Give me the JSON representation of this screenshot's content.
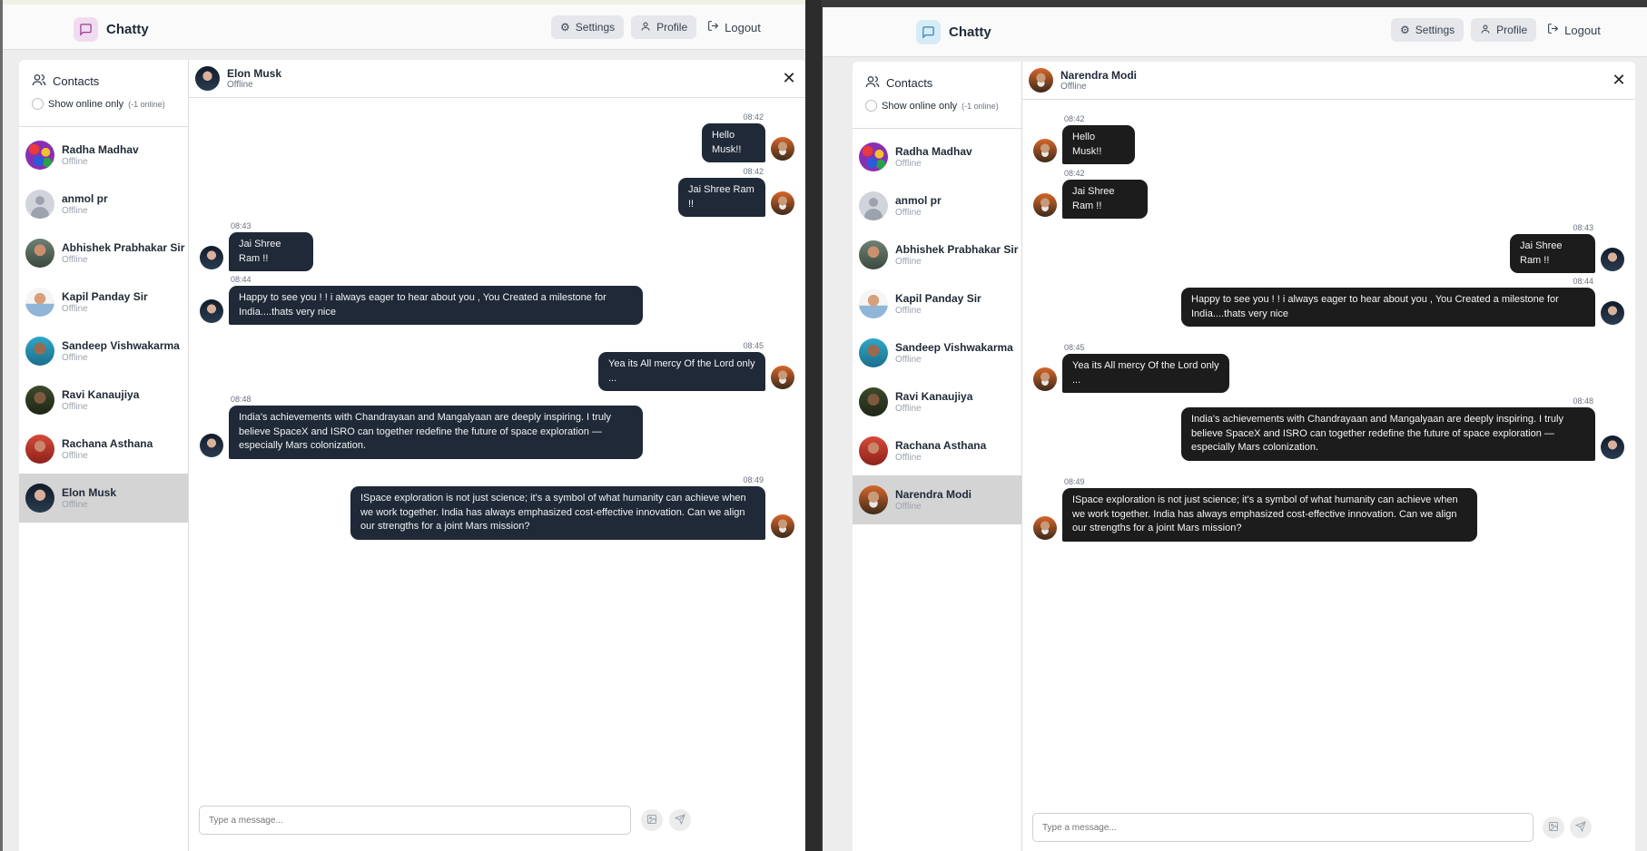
{
  "app": {
    "name": "Chatty"
  },
  "nav": {
    "settings": "Settings",
    "profile": "Profile",
    "logout": "Logout"
  },
  "sidebar": {
    "title": "Contacts",
    "filter_label": "Show online only",
    "online_count": "(-1 online)"
  },
  "composer": {
    "placeholder": "Type a message..."
  },
  "left": {
    "contacts": [
      {
        "name": "Radha Madhav",
        "status": "Offline",
        "avatar": "av-radha"
      },
      {
        "name": "anmol pr",
        "status": "Offline",
        "avatar": "av-anmol"
      },
      {
        "name": "Abhishek Prabhakar Sir",
        "status": "Offline",
        "avatar": "av-abhishek"
      },
      {
        "name": "Kapil Panday Sir",
        "status": "Offline",
        "avatar": "av-kapil"
      },
      {
        "name": "Sandeep Vishwakarma",
        "status": "Offline",
        "avatar": "av-sandeep"
      },
      {
        "name": "Ravi Kanaujiya",
        "status": "Offline",
        "avatar": "av-ravi"
      },
      {
        "name": "Rachana Asthana",
        "status": "Offline",
        "avatar": "av-rachana"
      },
      {
        "name": "Elon Musk",
        "status": "Offline",
        "avatar": "av-elon"
      }
    ],
    "chat_header": {
      "name": "Elon Musk",
      "status": "Offline"
    },
    "messages": [
      {
        "time": "08:42",
        "text": "Hello Musk!!"
      },
      {
        "time": "08:42",
        "text": "Jai Shree Ram !!"
      },
      {
        "time": "08:43",
        "text": "Jai Shree Ram !!"
      },
      {
        "time": "08:44",
        "text": "Happy to see you ! ! i always eager to hear about you , You Created a milestone for India....thats very nice"
      },
      {
        "time": "08:45",
        "text": "Yea its All mercy Of the Lord only ..."
      },
      {
        "time": "08:48",
        "text": "India's achievements with Chandrayaan and Mangalyaan are deeply inspiring. I truly believe SpaceX and ISRO can together redefine the future of space exploration — especially Mars colonization."
      },
      {
        "time": "08:49",
        "text": "ISpace exploration is not just science; it's a symbol of what humanity can achieve when we work together. India has always emphasized cost-effective innovation. Can we align our strengths for a joint Mars mission?"
      }
    ]
  },
  "right": {
    "contacts": [
      {
        "name": "Radha Madhav",
        "status": "Offline",
        "avatar": "av-radha"
      },
      {
        "name": "anmol pr",
        "status": "Offline",
        "avatar": "av-anmol"
      },
      {
        "name": "Abhishek Prabhakar Sir",
        "status": "Offline",
        "avatar": "av-abhishek"
      },
      {
        "name": "Kapil Panday Sir",
        "status": "Offline",
        "avatar": "av-kapil"
      },
      {
        "name": "Sandeep Vishwakarma",
        "status": "Offline",
        "avatar": "av-sandeep"
      },
      {
        "name": "Ravi Kanaujiya",
        "status": "Offline",
        "avatar": "av-ravi"
      },
      {
        "name": "Rachana Asthana",
        "status": "Offline",
        "avatar": "av-rachana"
      },
      {
        "name": "Narendra Modi",
        "status": "Offline",
        "avatar": "av-modi"
      }
    ],
    "chat_header": {
      "name": "Narendra Modi",
      "status": "Offline"
    },
    "messages": [
      {
        "time": "08:42",
        "text": "Hello Musk!!"
      },
      {
        "time": "08:42",
        "text": "Jai Shree Ram !!"
      },
      {
        "time": "08:43",
        "text": "Jai Shree Ram !!"
      },
      {
        "time": "08:44",
        "text": "Happy to see you ! ! i always eager to hear about you , You Created a milestone for India....thats very nice"
      },
      {
        "time": "08:45",
        "text": "Yea its All mercy Of the Lord only ..."
      },
      {
        "time": "08:48",
        "text": "India's achievements with Chandrayaan and Mangalyaan are deeply inspiring. I truly believe SpaceX and ISRO can together redefine the future of space exploration — especially Mars colonization."
      },
      {
        "time": "08:49",
        "text": "ISpace exploration is not just science; it's a symbol of what humanity can achieve when we work together. India has always emphasized cost-effective innovation. Can we align our strengths for a joint Mars mission?"
      }
    ]
  }
}
